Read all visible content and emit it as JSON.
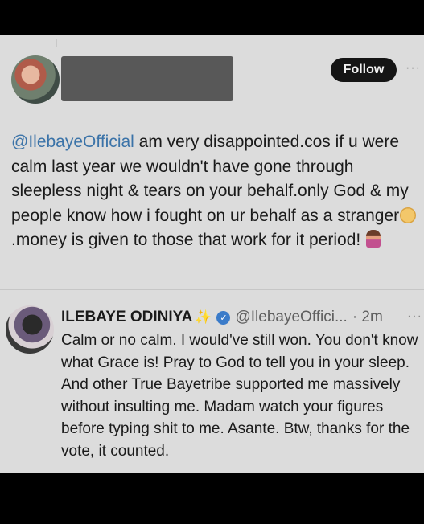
{
  "tweet": {
    "follow_label": "Follow",
    "more": "···",
    "mention": "@IlebayeOfficial",
    "text_part1": " am very disappointed.cos if u were calm last year we wouldn't have gone through sleepless night & tears on your behalf.only God & my people know how i fought on ur behalf as a stranger",
    "text_part2": ".money is given to those that work for it period!"
  },
  "reply": {
    "name": "ILEBAYE ODINIYA",
    "sparkle": "✨",
    "handle": "@IlebayeOffici...",
    "time": "· 2m",
    "more": "···",
    "text": "Calm or no calm. I would've still won. You don't know what Grace is! Pray to God to tell you in your sleep. And other True Bayetribe supported me massively without insulting me. Madam watch your figures before typing shit to me. Asante. Btw, thanks for the vote,  it counted."
  },
  "icons": {
    "verified": "verified-badge-icon",
    "person": "person-icon",
    "mute": "mute-icon"
  },
  "colors": {
    "mention": "#3b73a8",
    "follow_bg": "#151515",
    "verified": "#3a7bc9",
    "screen_bg": "#dcdcdc"
  }
}
